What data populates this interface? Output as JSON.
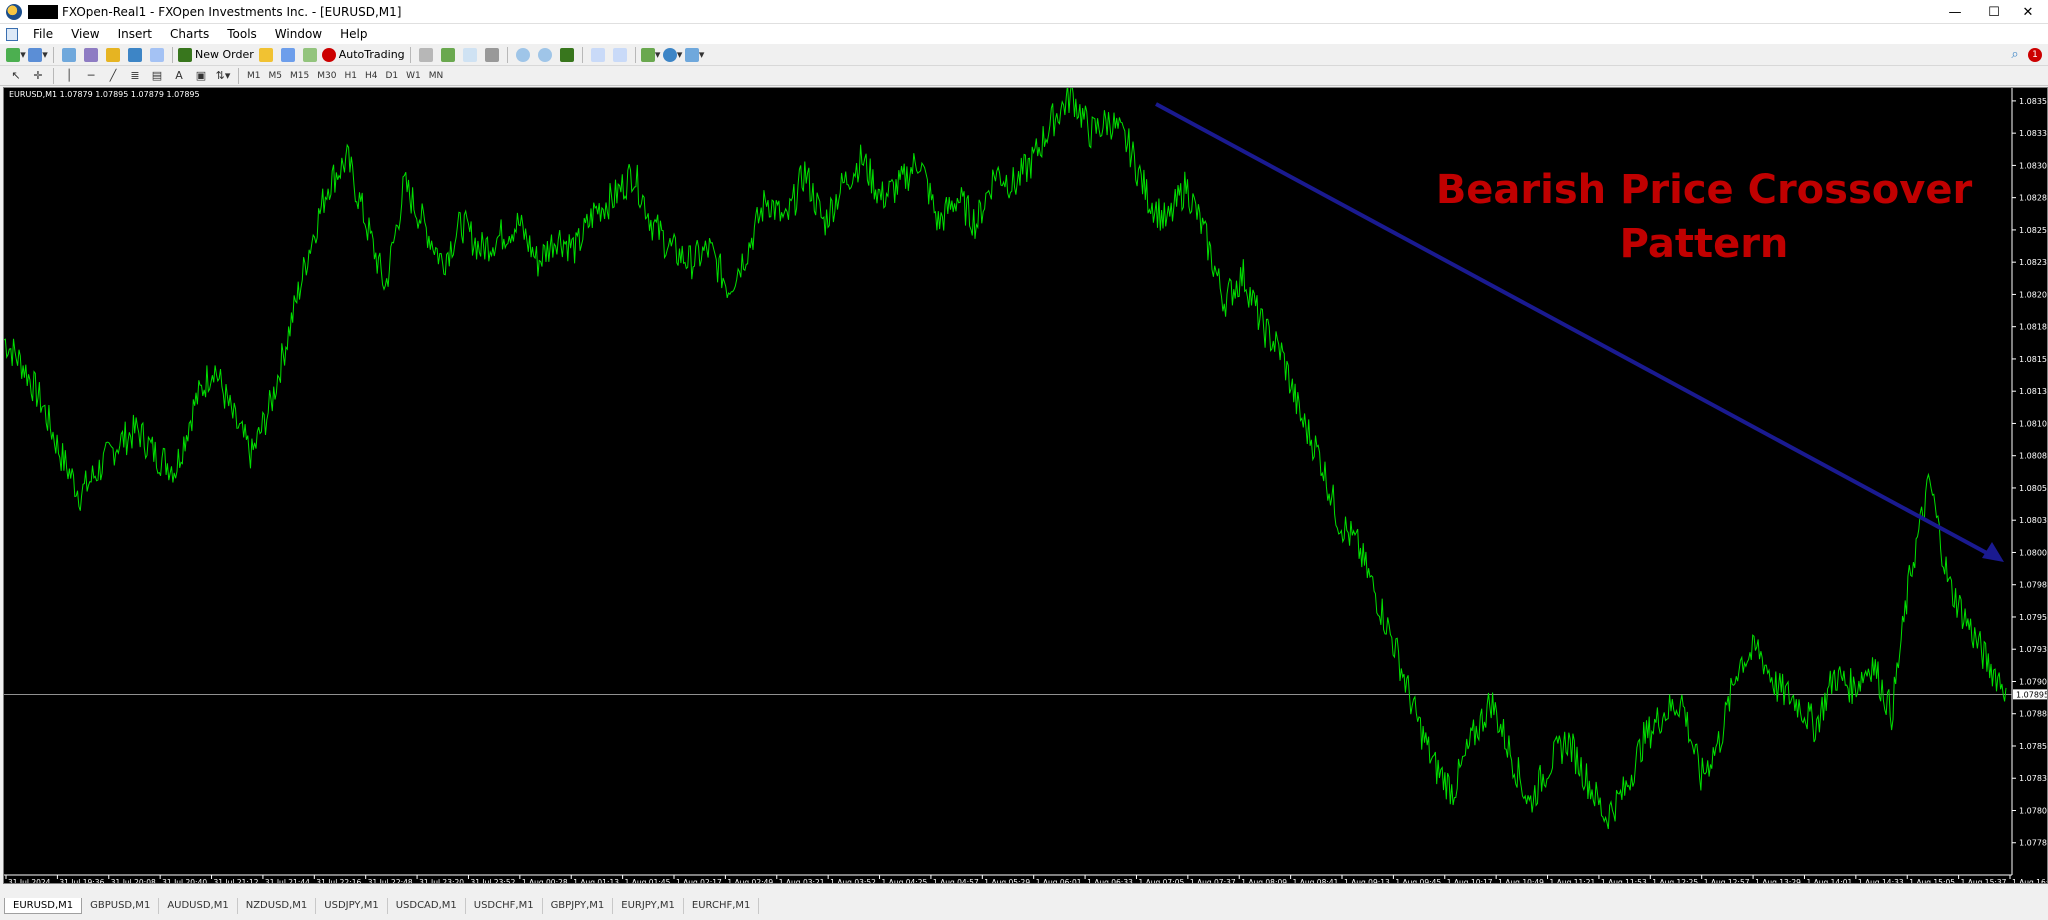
{
  "window": {
    "title": "FXOpen-Real1 - FXOpen Investments Inc. - [EURUSD,M1]",
    "minimize": "—",
    "maximize": "☐",
    "close": "✕"
  },
  "menu": [
    "File",
    "View",
    "Insert",
    "Charts",
    "Tools",
    "Window",
    "Help"
  ],
  "toolbar": {
    "new_order": "New Order",
    "auto_trading": "AutoTrading",
    "notification_count": "1"
  },
  "timeframes": [
    "M1",
    "M5",
    "M15",
    "M30",
    "H1",
    "H4",
    "D1",
    "W1",
    "MN"
  ],
  "chart": {
    "info": "EURUSD,M1  1.07879 1.07895 1.07879 1.07895",
    "overlay_title_line1": "Bearish Price Crossover",
    "overlay_title_line2": "Pattern",
    "current_price_label": "1.07895",
    "colors": {
      "line": "#00e000",
      "arrow": "#1a1a90",
      "overlay": "#c00000",
      "background": "#000000"
    }
  },
  "chart_data": {
    "type": "line",
    "title": "EURUSD,M1",
    "price_ticks": [
      "1.08355",
      "1.08330",
      "1.08305",
      "1.08280",
      "1.08255",
      "1.08230",
      "1.08205",
      "1.08180",
      "1.08155",
      "1.08130",
      "1.08105",
      "1.08080",
      "1.08055",
      "1.08030",
      "1.08005",
      "1.07980",
      "1.07955",
      "1.07930",
      "1.07905",
      "1.07880",
      "1.07855",
      "1.07830",
      "1.07805",
      "1.07780",
      "1.07755"
    ],
    "time_ticks": [
      "31 Jul 2024",
      "31 Jul 19:36",
      "31 Jul 20:08",
      "31 Jul 20:40",
      "31 Jul 21:12",
      "31 Jul 21:44",
      "31 Jul 22:16",
      "31 Jul 22:48",
      "31 Jul 23:20",
      "31 Jul 23:52",
      "1 Aug 00:28",
      "1 Aug 01:13",
      "1 Aug 01:45",
      "1 Aug 02:17",
      "1 Aug 02:49",
      "1 Aug 03:21",
      "1 Aug 03:52",
      "1 Aug 04:25",
      "1 Aug 04:57",
      "1 Aug 05:29",
      "1 Aug 06:01",
      "1 Aug 06:33",
      "1 Aug 07:05",
      "1 Aug 07:37",
      "1 Aug 08:09",
      "1 Aug 08:41",
      "1 Aug 09:13",
      "1 Aug 09:45",
      "1 Aug 10:17",
      "1 Aug 10:49",
      "1 Aug 11:21",
      "1 Aug 11:53",
      "1 Aug 12:25",
      "1 Aug 12:57",
      "1 Aug 13:29",
      "1 Aug 14:01",
      "1 Aug 14:33",
      "1 Aug 15:05",
      "1 Aug 15:37",
      "1 Aug 16:09"
    ],
    "ylim": [
      1.07755,
      1.08365
    ],
    "current_price": 1.07895,
    "series": [
      {
        "values": [
          [
            0,
            1.0817
          ],
          [
            1,
            1.0815
          ],
          [
            2,
            1.0812
          ],
          [
            3,
            1.0808
          ],
          [
            4,
            1.0805
          ],
          [
            5,
            1.0807
          ],
          [
            6,
            1.0809
          ],
          [
            7,
            1.081
          ],
          [
            8,
            1.0808
          ],
          [
            9,
            1.0807
          ],
          [
            10,
            1.0812
          ],
          [
            11,
            1.0815
          ],
          [
            12,
            1.0811
          ],
          [
            13,
            1.0808
          ],
          [
            14,
            1.0812
          ],
          [
            15,
            1.0818
          ],
          [
            16,
            1.0824
          ],
          [
            17,
            1.0829
          ],
          [
            18,
            1.0831
          ],
          [
            19,
            1.0826
          ],
          [
            20,
            1.0821
          ],
          [
            21,
            1.0829
          ],
          [
            22,
            1.0826
          ],
          [
            23,
            1.0823
          ],
          [
            24,
            1.0826
          ],
          [
            25,
            1.0824
          ],
          [
            26,
            1.0825
          ],
          [
            27,
            1.0826
          ],
          [
            28,
            1.0823
          ],
          [
            29,
            1.0825
          ],
          [
            30,
            1.0824
          ],
          [
            31,
            1.0827
          ],
          [
            32,
            1.0828
          ],
          [
            33,
            1.083
          ],
          [
            34,
            1.0826
          ],
          [
            35,
            1.0824
          ],
          [
            36,
            1.0823
          ],
          [
            37,
            1.0824
          ],
          [
            38,
            1.0821
          ],
          [
            39,
            1.0824
          ],
          [
            40,
            1.0828
          ],
          [
            41,
            1.0826
          ],
          [
            42,
            1.083
          ],
          [
            43,
            1.0826
          ],
          [
            44,
            1.0829
          ],
          [
            45,
            1.0831
          ],
          [
            46,
            1.0828
          ],
          [
            47,
            1.0829
          ],
          [
            48,
            1.0831
          ],
          [
            49,
            1.0826
          ],
          [
            50,
            1.0828
          ],
          [
            51,
            1.0826
          ],
          [
            52,
            1.083
          ],
          [
            53,
            1.0829
          ],
          [
            54,
            1.0831
          ],
          [
            55,
            1.0834
          ],
          [
            56,
            1.0836
          ],
          [
            57,
            1.0833
          ],
          [
            58,
            1.0834
          ],
          [
            59,
            1.0832
          ],
          [
            60,
            1.0828
          ],
          [
            61,
            1.0826
          ],
          [
            62,
            1.0829
          ],
          [
            63,
            1.0825
          ],
          [
            64,
            1.082
          ],
          [
            65,
            1.0822
          ],
          [
            66,
            1.0818
          ],
          [
            67,
            1.0816
          ],
          [
            68,
            1.0811
          ],
          [
            69,
            1.0808
          ],
          [
            70,
            1.0803
          ],
          [
            71,
            1.0801
          ],
          [
            72,
            1.0797
          ],
          [
            73,
            1.0793
          ],
          [
            74,
            1.0788
          ],
          [
            75,
            1.0784
          ],
          [
            76,
            1.0782
          ],
          [
            77,
            1.0786
          ],
          [
            78,
            1.0789
          ],
          [
            79,
            1.0785
          ],
          [
            80,
            1.0781
          ],
          [
            81,
            1.0784
          ],
          [
            82,
            1.0786
          ],
          [
            83,
            1.0783
          ],
          [
            84,
            1.078
          ],
          [
            85,
            1.0782
          ],
          [
            86,
            1.0786
          ],
          [
            87,
            1.0788
          ],
          [
            88,
            1.0789
          ],
          [
            89,
            1.0783
          ],
          [
            90,
            1.0786
          ],
          [
            91,
            1.0792
          ],
          [
            92,
            1.0793
          ],
          [
            93,
            1.079
          ],
          [
            94,
            1.0789
          ],
          [
            95,
            1.0787
          ],
          [
            96,
            1.0791
          ],
          [
            97,
            1.079
          ],
          [
            98,
            1.0792
          ],
          [
            99,
            1.0788
          ],
          [
            100,
            1.0799
          ],
          [
            101,
            1.0806
          ],
          [
            102,
            1.0798
          ],
          [
            103,
            1.0795
          ],
          [
            104,
            1.0792
          ],
          [
            105,
            1.079
          ]
        ]
      }
    ]
  }
}
